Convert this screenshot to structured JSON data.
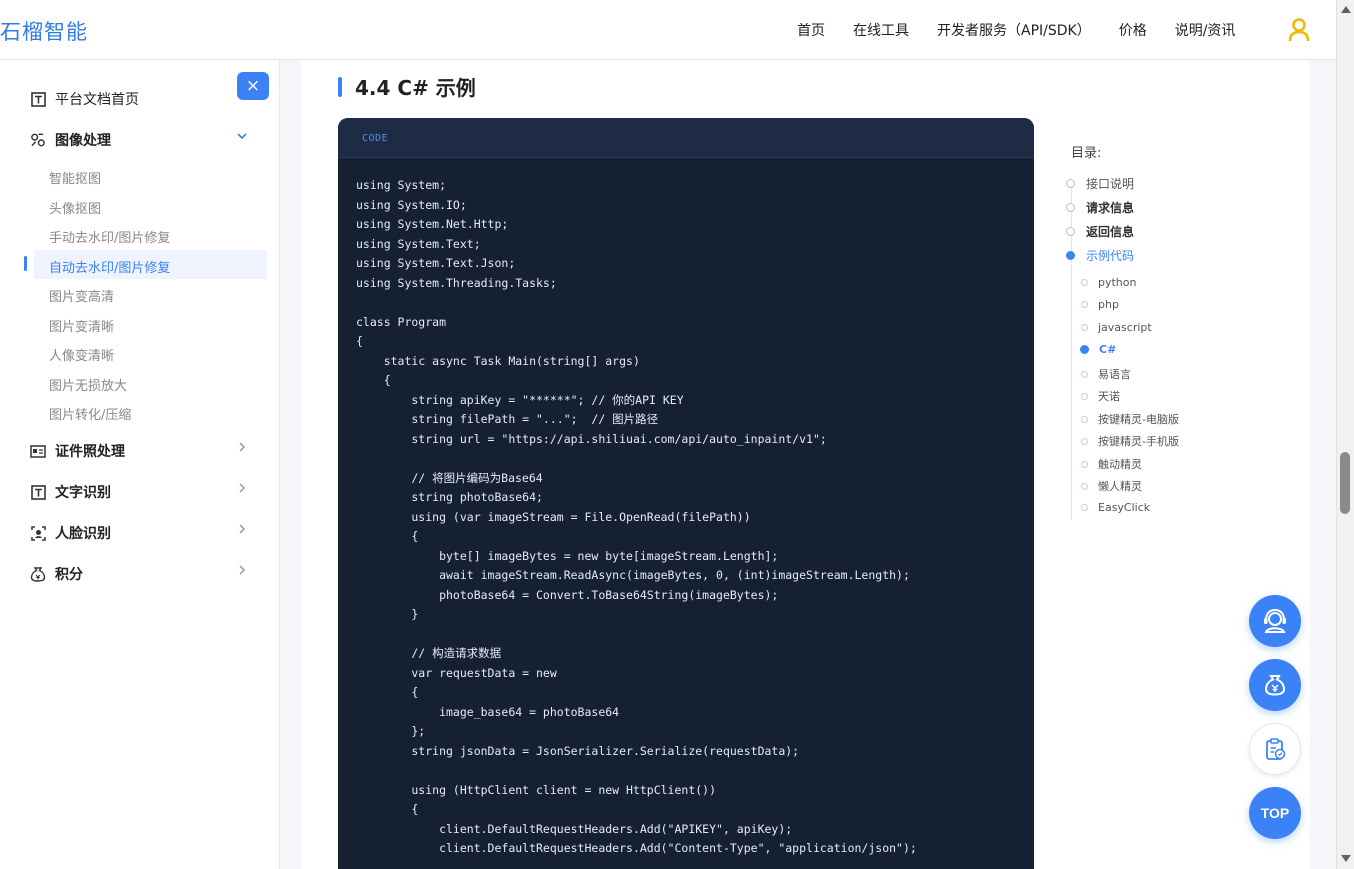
{
  "header": {
    "logo": "石榴智能",
    "nav": [
      "首页",
      "在线工具",
      "开发者服务（API/SDK）",
      "价格",
      "说明/资讯"
    ],
    "user_icon": "user-icon"
  },
  "sidebar": {
    "close_label": "×",
    "home": "平台文档首页",
    "image_processing": "图像处理",
    "image_sub": [
      "智能抠图",
      "头像抠图",
      "手动去水印/图片修复",
      "自动去水印/图片修复",
      "图片变高清",
      "图片变清晰",
      "人像变清晰",
      "图片无损放大",
      "图片转化/压缩"
    ],
    "active_sub": "自动去水印/图片修复",
    "id_photo": "证件照处理",
    "ocr": "文字识别",
    "face": "人脸识别",
    "points": "积分"
  },
  "main": {
    "section_title": "4.4 C# 示例",
    "code_tag": "CODE",
    "code_lines": [
      "using System;",
      "using System.IO;",
      "using System.Net.Http;",
      "using System.Text;",
      "using System.Text.Json;",
      "using System.Threading.Tasks;",
      "",
      "class Program",
      "{",
      "    static async Task Main(string[] args)",
      "    {",
      "        string apiKey = \"******\"; // 你的API KEY",
      "        string filePath = \"...\";  // 图片路径",
      "        string url = \"https://api.shiliuai.com/api/auto_inpaint/v1\";",
      "",
      "        // 将图片编码为Base64",
      "        string photoBase64;",
      "        using (var imageStream = File.OpenRead(filePath))",
      "        {",
      "            byte[] imageBytes = new byte[imageStream.Length];",
      "            await imageStream.ReadAsync(imageBytes, 0, (int)imageStream.Length);",
      "            photoBase64 = Convert.ToBase64String(imageBytes);",
      "        }",
      "",
      "        // 构造请求数据",
      "        var requestData = new",
      "        {",
      "            image_base64 = photoBase64",
      "        };",
      "        string jsonData = JsonSerializer.Serialize(requestData);",
      "",
      "        using (HttpClient client = new HttpClient())",
      "        {",
      "            client.DefaultRequestHeaders.Add(\"APIKEY\", apiKey);",
      "            client.DefaultRequestHeaders.Add(\"Content-Type\", \"application/json\");"
    ]
  },
  "toc": {
    "title": "目录:",
    "items": [
      "接口说明",
      "请求信息",
      "返回信息",
      "示例代码"
    ],
    "active_item": "示例代码",
    "sub": [
      "python",
      "php",
      "javascript",
      "C#",
      "易语言",
      "天诺",
      "按键精灵-电脑版",
      "按键精灵-手机版",
      "触动精灵",
      "懒人精灵",
      "EasyClick"
    ],
    "active_sub": "C#"
  },
  "floating": {
    "support_icon": "customer-service-icon",
    "money_icon": "money-bag-icon",
    "clipboard_icon": "clipboard-icon",
    "top_label": "TOP"
  },
  "colors": {
    "accent": "#3b82f6",
    "code_bg": "#162033",
    "user_icon": "#f5b800"
  }
}
